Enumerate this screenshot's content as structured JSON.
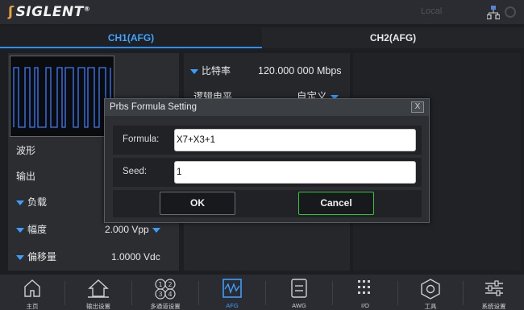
{
  "topbar": {
    "brand": "SIGLENT",
    "status": "Local",
    "icons": [
      "network-icon",
      "clock-icon"
    ]
  },
  "tabs": [
    {
      "label": "CH1(AFG)",
      "active": true
    },
    {
      "label": "CH2(AFG)",
      "active": false
    }
  ],
  "left_params": {
    "waveform_label": "波形",
    "output_label": "输出",
    "load_label": "负载",
    "amplitude_label": "幅度",
    "amplitude_value": "2.000 Vpp",
    "offset_label": "偏移量",
    "offset_value": "1.0000 Vdc"
  },
  "mid_params": {
    "bitrate_label": "比特率",
    "bitrate_value": "120.000 000 Mbps",
    "logic_label": "逻辑电平",
    "logic_value": "自定义"
  },
  "dialog": {
    "title": "Prbs Formula Setting",
    "close_label": "X",
    "formula_label": "Formula:",
    "formula_value": "X7+X3+1",
    "seed_label": "Seed:",
    "seed_value": "1",
    "ok_label": "OK",
    "cancel_label": "Cancel",
    "cancel_highlight_color": "#2dc83c"
  },
  "bottom_nav": [
    {
      "label": "主页",
      "icon": "home-icon"
    },
    {
      "label": "输出设置",
      "icon": "output-icon"
    },
    {
      "label": "多通道设置",
      "icon": "multichannel-icon"
    },
    {
      "label": "AFG",
      "icon": "afg-waveform-icon",
      "active": true
    },
    {
      "label": "AWG",
      "icon": "awg-icon"
    },
    {
      "label": "I/O",
      "icon": "io-icon"
    },
    {
      "label": "工具",
      "icon": "tools-icon"
    },
    {
      "label": "系统设置",
      "icon": "settings-icon"
    }
  ],
  "colors": {
    "accent": "#2f8df0",
    "background": "#1c1e22"
  }
}
